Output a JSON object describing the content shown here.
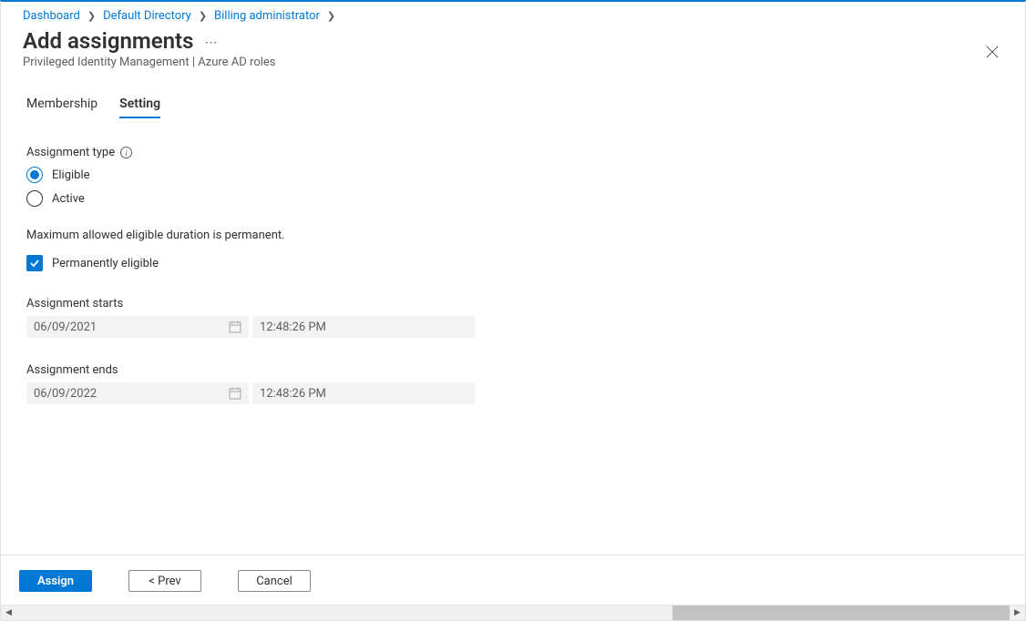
{
  "breadcrumbs": {
    "items": [
      "Dashboard",
      "Default Directory",
      "Billing administrator"
    ]
  },
  "header": {
    "title": "Add assignments",
    "subtitle": "Privileged Identity Management | Azure AD roles"
  },
  "tabs": {
    "membership": "Membership",
    "setting": "Setting",
    "active": "setting"
  },
  "form": {
    "assignment_type_label": "Assignment type",
    "radio_eligible": "Eligible",
    "radio_active": "Active",
    "radio_selected": "eligible",
    "max_duration_text": "Maximum allowed eligible duration is permanent.",
    "permanently_eligible_label": "Permanently eligible",
    "permanently_eligible_checked": true,
    "start_label": "Assignment starts",
    "start_date": "06/09/2021",
    "start_time": "12:48:26 PM",
    "end_label": "Assignment ends",
    "end_date": "06/09/2022",
    "end_time": "12:48:26 PM"
  },
  "footer": {
    "assign": "Assign",
    "prev": "<  Prev",
    "cancel": "Cancel"
  }
}
